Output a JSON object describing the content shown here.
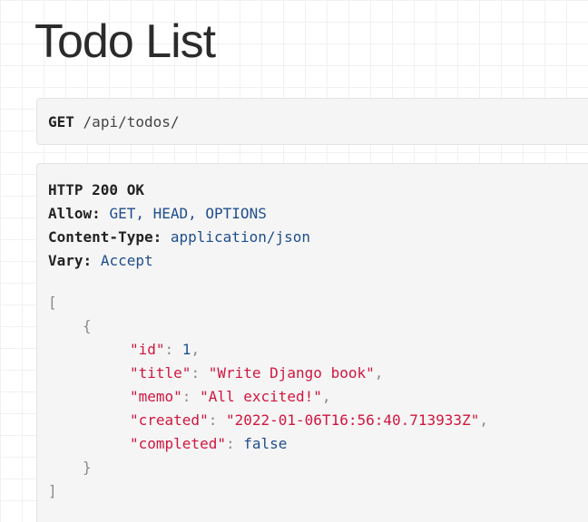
{
  "page": {
    "title": "Todo List"
  },
  "request": {
    "method": "GET",
    "path": "/api/todos/"
  },
  "response": {
    "status": "HTTP 200 OK",
    "headers": [
      {
        "key": "Allow:",
        "value": "GET, HEAD, OPTIONS"
      },
      {
        "key": "Content-Type:",
        "value": "application/json"
      },
      {
        "key": "Vary:",
        "value": "Accept"
      }
    ],
    "body": {
      "open_bracket": "[",
      "close_bracket": "]",
      "open_brace": "{",
      "close_brace": "}",
      "fields": [
        {
          "key": "\"id\"",
          "value": "1",
          "type": "num",
          "trail": ","
        },
        {
          "key": "\"title\"",
          "value": "\"Write Django book\"",
          "type": "str",
          "trail": ","
        },
        {
          "key": "\"memo\"",
          "value": "\"All excited!\"",
          "type": "str",
          "trail": ","
        },
        {
          "key": "\"created\"",
          "value": "\"2022-01-06T16:56:40.713933Z\"",
          "type": "str",
          "trail": ","
        },
        {
          "key": "\"completed\"",
          "value": "false",
          "type": "lit",
          "trail": ""
        }
      ]
    }
  },
  "colors": {
    "json_key": "#d0163f",
    "json_string": "#d0163f",
    "json_literal": "#1f4e8c",
    "header_value": "#1f4e8c"
  }
}
